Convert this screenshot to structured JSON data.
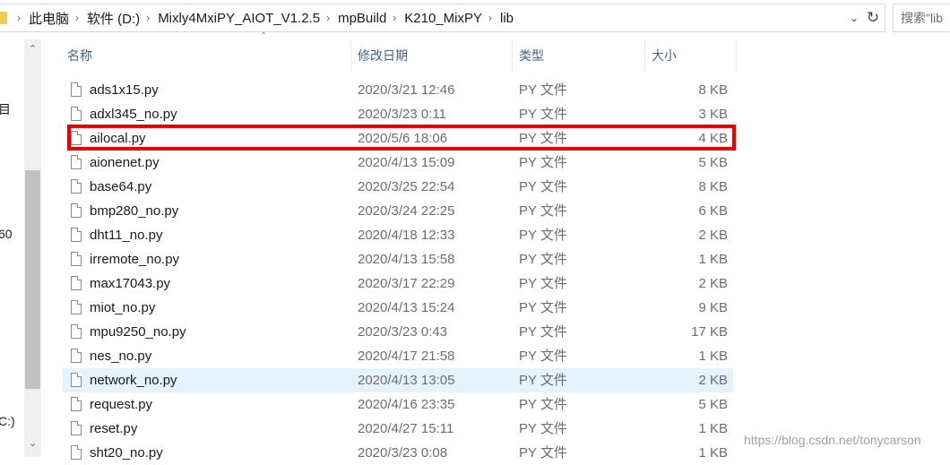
{
  "address_bar": {
    "breadcrumbs": [
      "此电脑",
      "软件 (D:)",
      "Mixly4MxiPY_AIOT_V1.2.5",
      "mpBuild",
      "K210_MixPY",
      "lib"
    ],
    "search_placeholder": "搜索\"lib"
  },
  "nav_pane": {
    "fragments": [
      "目",
      "60",
      "C:)"
    ]
  },
  "columns": {
    "name": "名称",
    "date": "修改日期",
    "type": "类型",
    "size": "大小"
  },
  "files": [
    {
      "name": "ads1x15.py",
      "date": "2020/3/21 12:46",
      "type": "PY 文件",
      "size": "8 KB"
    },
    {
      "name": "adxl345_no.py",
      "date": "2020/3/23 0:11",
      "type": "PY 文件",
      "size": "3 KB"
    },
    {
      "name": "ailocal.py",
      "date": "2020/5/6 18:06",
      "type": "PY 文件",
      "size": "4 KB"
    },
    {
      "name": "aionenet.py",
      "date": "2020/4/13 15:09",
      "type": "PY 文件",
      "size": "5 KB"
    },
    {
      "name": "base64.py",
      "date": "2020/3/25 22:54",
      "type": "PY 文件",
      "size": "8 KB"
    },
    {
      "name": "bmp280_no.py",
      "date": "2020/3/24 22:25",
      "type": "PY 文件",
      "size": "6 KB"
    },
    {
      "name": "dht11_no.py",
      "date": "2020/4/18 12:33",
      "type": "PY 文件",
      "size": "2 KB"
    },
    {
      "name": "irremote_no.py",
      "date": "2020/4/13 15:58",
      "type": "PY 文件",
      "size": "1 KB"
    },
    {
      "name": "max17043.py",
      "date": "2020/3/17 22:29",
      "type": "PY 文件",
      "size": "2 KB"
    },
    {
      "name": "miot_no.py",
      "date": "2020/4/13 15:24",
      "type": "PY 文件",
      "size": "9 KB"
    },
    {
      "name": "mpu9250_no.py",
      "date": "2020/3/23 0:43",
      "type": "PY 文件",
      "size": "17 KB"
    },
    {
      "name": "nes_no.py",
      "date": "2020/4/17 21:58",
      "type": "PY 文件",
      "size": "1 KB"
    },
    {
      "name": "network_no.py",
      "date": "2020/4/13 13:05",
      "type": "PY 文件",
      "size": "2 KB"
    },
    {
      "name": "request.py",
      "date": "2020/4/16 23:35",
      "type": "PY 文件",
      "size": "5 KB"
    },
    {
      "name": "reset.py",
      "date": "2020/4/27 15:11",
      "type": "PY 文件",
      "size": "1 KB"
    },
    {
      "name": "sht20_no.py",
      "date": "2020/3/23 0:08",
      "type": "PY 文件",
      "size": "1 KB"
    }
  ],
  "hovered_file": "network_no.py",
  "highlighted_file": "ailocal.py",
  "watermark": "https://blog.csdn.net/tonycarson",
  "colors": {
    "highlight_border": "#e60000",
    "hover_row": "#e5f3ff",
    "header_text": "#4d6082",
    "scroll_thumb": "#c1c1c1"
  },
  "icons": {
    "folder": "folder-icon",
    "file": "file-icon",
    "dropdown": "chevron-down-icon",
    "refresh": "refresh-icon",
    "scroll_up": "chevron-up-icon",
    "scroll_down": "chevron-down-icon"
  }
}
